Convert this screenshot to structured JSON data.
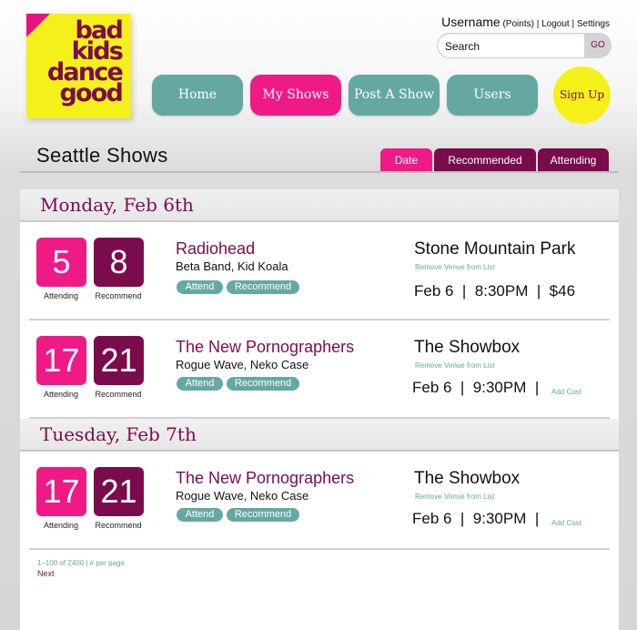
{
  "logo": {
    "line1": "bad",
    "line2": "kids",
    "line3": "dance",
    "line4": "good"
  },
  "account": {
    "username": "Username",
    "points": "(Points)",
    "sep1": "|",
    "logout": "Logout",
    "sep2": "|",
    "settings": "Settings"
  },
  "search": {
    "placeholder": "Search",
    "go": "GO"
  },
  "nav": {
    "home": "Home",
    "my_shows": "My Shows",
    "post_show": "Post A Show",
    "users": "Users",
    "signup": "Sign Up"
  },
  "page": {
    "title": "Seattle Shows"
  },
  "sort_tabs": {
    "date": "Date",
    "recommended": "Recommended",
    "attending": "Attending"
  },
  "labels": {
    "attending": "Attending",
    "recommend": "Recommend",
    "attend_btn": "Attend",
    "recommend_btn": "Recommend",
    "remove_venue": "Remove Venue from List",
    "add_cost": "Add Cost"
  },
  "days": [
    {
      "date": "Monday, Feb 6th",
      "shows": [
        {
          "attending": "5",
          "recommend": "8",
          "band": "Radiohead",
          "support": "Beta Band, Kid Koala",
          "venue": "Stone Mountain Park",
          "when": "Feb 6  |  8:30PM  |  $46"
        },
        {
          "attending": "17",
          "recommend": "21",
          "band": "The New Pornographers",
          "support": "Rogue Wave, Neko Case",
          "venue": "The Showbox",
          "when": "Feb 6  |  9:30PM  |"
        }
      ]
    },
    {
      "date": "Tuesday, Feb 7th",
      "shows": [
        {
          "attending": "17",
          "recommend": "21",
          "band": "The New Pornographers",
          "support": "Rogue Wave, Neko Case",
          "venue": "The Showbox",
          "when": "Feb 6  |  9:30PM  |"
        }
      ]
    }
  ],
  "pagination": {
    "range": "1–100 of 2400 | # per page",
    "next": "Next"
  },
  "colors": {
    "magenta": "#ef1a86",
    "plum": "#7a0c4c",
    "teal": "#65a8a2",
    "yellow": "#f5f01a"
  }
}
